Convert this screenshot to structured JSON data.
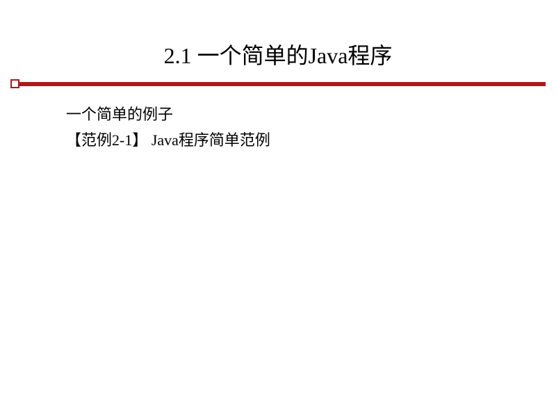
{
  "slide": {
    "title": "2.1  一个简单的Java程序",
    "body": {
      "line1": "一个简单的例子",
      "line2": "【范例2-1】  Java程序简单范例"
    }
  }
}
